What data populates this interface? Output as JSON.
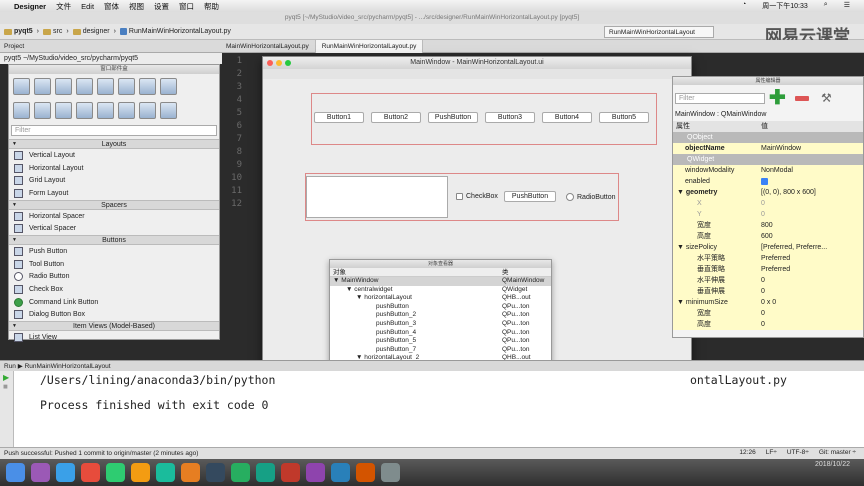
{
  "menubar": {
    "app": "Designer",
    "items": [
      "文件",
      "Edit",
      "窗体",
      "视图",
      "设置",
      "窗口",
      "帮助"
    ],
    "clock": "周一下午10:33"
  },
  "pycharm": {
    "title": "pyqt5 [~/MyStudio/video_src/pycharm/pyqt5] - .../src/designer/RunMainWinHorizontalLayout.py [pyqt5]",
    "crumbs": [
      "pyqt5",
      "src",
      "designer",
      "RunMainWinHorizontalLayout.py"
    ],
    "run_config": "RunMainWinHorizontalLayout",
    "project_label": "Project",
    "tabs": [
      "MainWinHorizontalLayout.py",
      "RunMainWinHorizontalLayout.py"
    ],
    "project_root": "pyqt5 ~/MyStudio/video_src/pycharm/pyqt5",
    "line_numbers": [
      "1",
      "2",
      "3",
      "4",
      "5",
      "6",
      "7",
      "8",
      "9",
      "10",
      "11",
      "12"
    ]
  },
  "watermark": "网易云课堂",
  "widgetbox": {
    "title": "窗口部件盒",
    "filter_placeholder": "Filter",
    "layouts_header": "Layouts",
    "layouts": [
      "Vertical Layout",
      "Horizontal Layout",
      "Grid Layout",
      "Form Layout"
    ],
    "spacers_header": "Spacers",
    "spacers": [
      "Horizontal Spacer",
      "Vertical Spacer"
    ],
    "buttons_header": "Buttons",
    "buttons": [
      "Push Button",
      "Tool Button",
      "Radio Button",
      "Check Box",
      "Command Link Button",
      "Dialog Button Box"
    ],
    "item_views_header": "Item Views (Model-Based)",
    "item_views": [
      "List View"
    ]
  },
  "mainwin": {
    "title": "MainWindow - MainWinHorizontalLayout.ui",
    "row1": [
      "Button1",
      "Button2",
      "PushButton",
      "Button3",
      "Button4",
      "Button5"
    ],
    "checkbox": "CheckBox",
    "pushbutton": "PushButton",
    "radiobutton": "RadioButton"
  },
  "objinsp": {
    "title": "对象查看器",
    "col_obj": "对象",
    "col_class": "类",
    "rows": [
      {
        "name": "MainWindow",
        "cls": "QMainWindow"
      },
      {
        "name": "centralwidget",
        "cls": "QWidget"
      },
      {
        "name": "horizontalLayout",
        "cls": "QHB...out"
      },
      {
        "name": "pushButton",
        "cls": "QPu...ton"
      },
      {
        "name": "pushButton_2",
        "cls": "QPu...ton"
      },
      {
        "name": "pushButton_3",
        "cls": "QPu...ton"
      },
      {
        "name": "pushButton_4",
        "cls": "QPu...ton"
      },
      {
        "name": "pushButton_5",
        "cls": "QPu...ton"
      },
      {
        "name": "pushButton_7",
        "cls": "QPu...ton"
      },
      {
        "name": "horizontalLayout_2",
        "cls": "QHB...out"
      }
    ]
  },
  "propedit": {
    "title": "属性编辑器",
    "filter_placeholder": "Filter",
    "object_label": "MainWindow : QMainWindow",
    "col_prop": "属性",
    "col_val": "值",
    "rows": [
      {
        "k": "QObject",
        "v": ""
      },
      {
        "k": "objectName",
        "v": "MainWindow"
      },
      {
        "k": "QWidget",
        "v": ""
      },
      {
        "k": "windowModality",
        "v": "NonModal"
      },
      {
        "k": "enabled",
        "v": ""
      },
      {
        "k": "geometry",
        "v": "[(0, 0), 800 x 600]"
      },
      {
        "k": "X",
        "v": "0"
      },
      {
        "k": "Y",
        "v": "0"
      },
      {
        "k": "宽度",
        "v": "800"
      },
      {
        "k": "高度",
        "v": "600"
      },
      {
        "k": "sizePolicy",
        "v": "[Preferred, Preferre..."
      },
      {
        "k": "水平策略",
        "v": "Preferred"
      },
      {
        "k": "垂直策略",
        "v": "Preferred"
      },
      {
        "k": "水平伸展",
        "v": "0"
      },
      {
        "k": "垂直伸展",
        "v": "0"
      },
      {
        "k": "minimumSize",
        "v": "0 x 0"
      },
      {
        "k": "宽度",
        "v": "0"
      },
      {
        "k": "高度",
        "v": "0"
      }
    ]
  },
  "run": {
    "header_label": "Run",
    "header_config": "RunMainWinHorizontalLayout",
    "line1": "/Users/lining/anaconda3/bin/python",
    "line1_end": "ontalLayout.py",
    "line2": "Process finished with exit code 0"
  },
  "status": {
    "message": "Push successful: Pushed 1 commit to origin/master (2 minutes ago)",
    "pos": "12:26",
    "lf": "LF÷",
    "enc": "UTF-8÷",
    "git": "Git: master ÷",
    "date": "2018/10/22"
  }
}
